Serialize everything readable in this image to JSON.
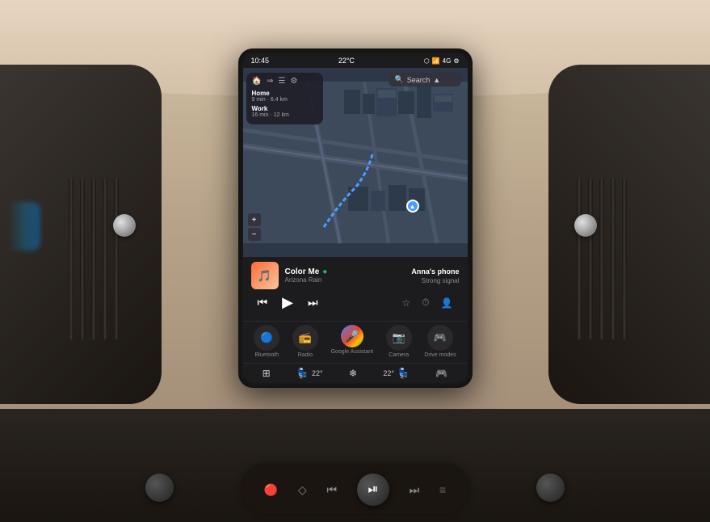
{
  "status_bar": {
    "time": "10:45",
    "temp": "22°C",
    "icons": [
      "bluetooth",
      "wifi",
      "signal",
      "4g"
    ],
    "settings_icon": "⚙"
  },
  "map": {
    "search_placeholder": "Search",
    "zoom_in": "+",
    "zoom_out": "−",
    "destinations": [
      {
        "label": "Home",
        "time": "9 min · 6.4 km"
      },
      {
        "label": "Work",
        "time": "16 min · 12 km"
      }
    ]
  },
  "media": {
    "track_name": "Color Me",
    "track_artist": "Arizona Rain",
    "album_emoji": "🎵",
    "phone_label": "Anna's phone",
    "signal_label": "Strong signal",
    "prev_icon": "⏮",
    "play_icon": "▶",
    "next_icon": "⏭",
    "favorite_icon": "☆",
    "recent_icon": "⏱",
    "contacts_icon": "👤"
  },
  "quick_access": [
    {
      "icon": "🔵",
      "label": "Bluetooth"
    },
    {
      "icon": "📻",
      "label": "Radio"
    },
    {
      "icon": "🎤",
      "label": "Google Assistant"
    },
    {
      "icon": "📷",
      "label": "Camera"
    },
    {
      "icon": "🎮",
      "label": "Drive modes"
    }
  ],
  "bottom_controls": {
    "apps_icon": "⊞",
    "seat_temp_left": "22°",
    "fan_icon": "❄",
    "seat_temp_right": "22°",
    "steering_icon": "🎮"
  },
  "center_console": {
    "btn1": "🔴",
    "btn2": "⬦",
    "btn3": "⏮",
    "play_pause": "⏯",
    "btn4": "⏭",
    "btn5": "≡"
  },
  "colors": {
    "screen_bg": "#1c1c1e",
    "map_bg": "#3d4a5c",
    "road_color": "#4a5568",
    "building_color": "#2d3a4a",
    "accent_blue": "#4a9eff",
    "accent_green": "#1db954",
    "text_primary": "#ffffff",
    "text_secondary": "#888888",
    "dashboard_dark": "#1a1510",
    "dashboard_mid": "#2a2520"
  }
}
